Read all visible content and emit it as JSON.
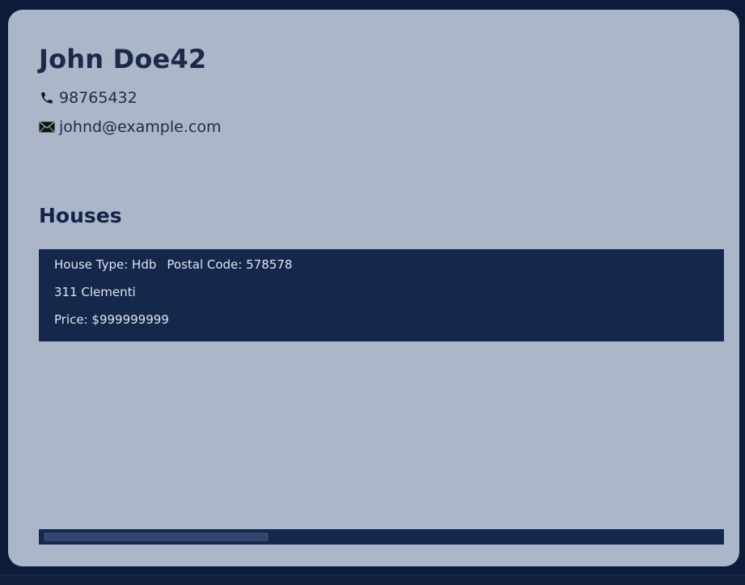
{
  "person": {
    "name": "John Doe42",
    "phone": "98765432",
    "email": "johnd@example.com"
  },
  "houses_section": {
    "title": "Houses",
    "items": [
      {
        "house_type_text": "House Type: Hdb",
        "postal_code_text": "Postal Code: 578578",
        "address": "311 Clementi",
        "price_text": "Price: $999999999"
      }
    ]
  },
  "icons": {
    "phone": "phone-icon",
    "email": "envelope-icon"
  },
  "colors": {
    "background": "#0d1b3a",
    "card": "#abb6c8",
    "house_card": "#15274a",
    "title_text": "#1b2a49"
  }
}
